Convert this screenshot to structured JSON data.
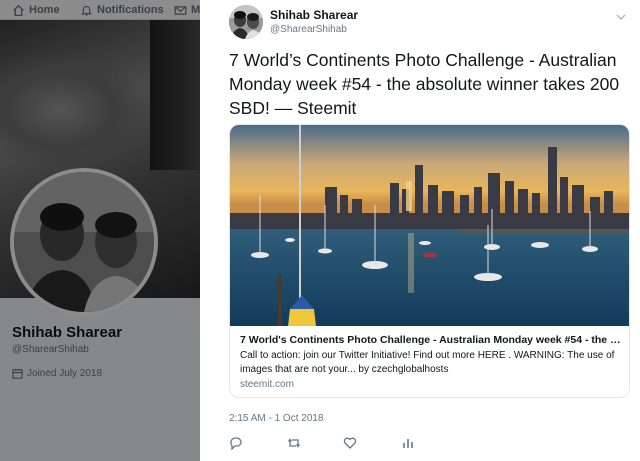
{
  "nav": {
    "home_label": "Home",
    "notifications_label": "Notifications",
    "messages_label": "M"
  },
  "profile": {
    "name": "Shihab Sharear",
    "handle": "@SharearShihab",
    "joined": "Joined July 2018"
  },
  "tweet": {
    "author_name": "Shihab Sharear",
    "author_handle": "@SharearShihab",
    "text": "7 World’s Continents Photo Challenge - Australian Monday week #54 - the absolute winner takes 200 SBD! — Steemit",
    "timestamp": "2:15 AM - 1 Oct 2018",
    "card": {
      "title": "7 World's Continents Photo Challenge - Australian Monday week #54 - the ab...",
      "description": "Call to action: join our Twitter Initiative! Find out more HERE . WARNING: The use of images that are not your... by czechglobalhosts",
      "domain": "steemit.com"
    }
  },
  "icons": {
    "home": "home-icon",
    "notifications": "bell-icon",
    "messages": "envelope-icon",
    "joined": "calendar-icon",
    "more": "chevron-down-icon",
    "reply": "reply-icon",
    "retweet": "retweet-icon",
    "like": "heart-icon",
    "stats": "analytics-icon"
  },
  "colors": {
    "text_primary": "#14171a",
    "text_secondary": "#657786",
    "border": "#e1e8ed"
  }
}
